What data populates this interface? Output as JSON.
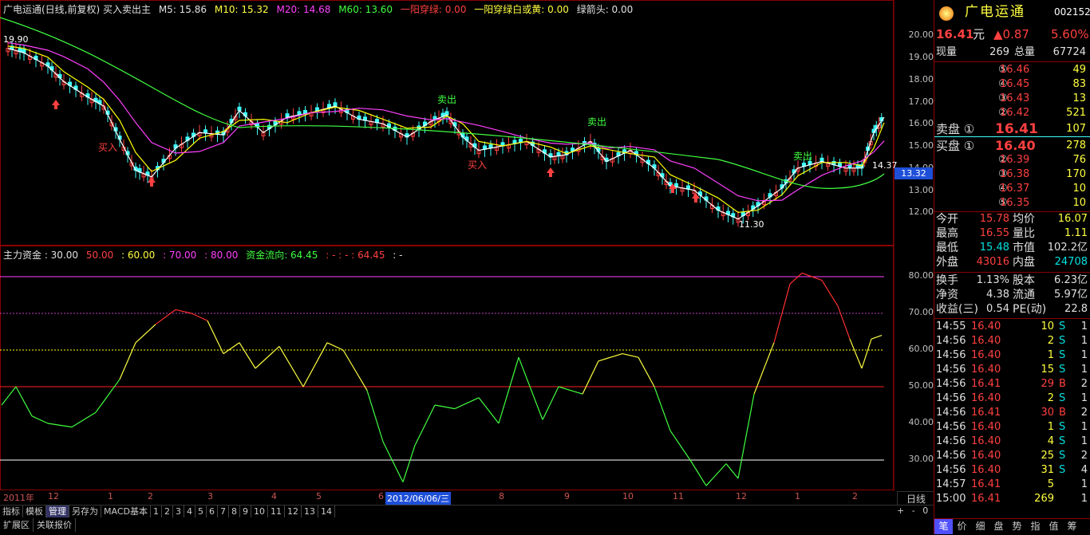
{
  "header": {
    "title": "广电运通(日线,前复权) 买入卖出主",
    "m5": "M5: 15.86",
    "m10": "M10: 15.32",
    "m20": "M20: 14.68",
    "m60": "M60: 13.60",
    "sig1": "一阳穿绿: 0.00",
    "sig2": "一阳穿绿白或黄: 0.00",
    "sig3": "绿箭头: 0.00"
  },
  "indicator_header": {
    "name": "主力资金 : 30.00",
    "v50": "50.00",
    "v60": ": 60.00",
    "v70": ": 70.00",
    "v80": ": 80.00",
    "flow": "资金流向: 64.45",
    "flow2": ": - : - : 64.45",
    "tail": ": -"
  },
  "price_axis": [
    "20.00",
    "19.00",
    "18.00",
    "17.00",
    "16.00",
    "15.00",
    "14.00",
    "13.00",
    "12.00"
  ],
  "cursor_price": "13.32",
  "ind_axis": [
    "80.00",
    "70.00",
    "60.00",
    "50.00",
    "40.00",
    "30.00"
  ],
  "chart_labels": {
    "high": "19.90",
    "low": "11.30",
    "right": "14.37",
    "buy": "买入",
    "sell": "卖出"
  },
  "x_labels": [
    "2011年",
    "12",
    "1",
    "2",
    "3",
    "4",
    "5",
    "6",
    "8",
    "9",
    "10",
    "11",
    "12",
    "1",
    "2"
  ],
  "date_cursor": "2012/06/06/三",
  "period": "日线",
  "bottom_tabs": [
    "指标",
    "模板",
    "管理",
    "另存为",
    "MACD基本",
    "1",
    "2",
    "3",
    "4",
    "5",
    "6",
    "7",
    "8",
    "9",
    "10",
    "11",
    "12",
    "13",
    "14"
  ],
  "bottom_tabs2": [
    "扩展区",
    "关联报价"
  ],
  "nav_buttons": [
    "+",
    "-",
    "0"
  ],
  "quote": {
    "name": "广电运通",
    "code": "002152",
    "price": "16.41",
    "unit": "元",
    "change": "▲0.87",
    "pct": "5.60%",
    "cur_vol_label": "现量",
    "cur_vol": "269",
    "total_vol_label": "总量",
    "total_vol": "67724",
    "asks": [
      {
        "lvl": "⑤",
        "p": "16.46",
        "v": "49"
      },
      {
        "lvl": "④",
        "p": "16.45",
        "v": "83"
      },
      {
        "lvl": "③",
        "p": "16.43",
        "v": "13"
      },
      {
        "lvl": "②",
        "p": "16.42",
        "v": "521"
      },
      {
        "lvl": "卖盘 ①",
        "p": "16.41",
        "v": "107"
      }
    ],
    "bids": [
      {
        "lvl": "买盘 ①",
        "p": "16.40",
        "v": "278"
      },
      {
        "lvl": "②",
        "p": "16.39",
        "v": "76"
      },
      {
        "lvl": "③",
        "p": "16.38",
        "v": "170"
      },
      {
        "lvl": "④",
        "p": "16.37",
        "v": "10"
      },
      {
        "lvl": "⑤",
        "p": "16.35",
        "v": "10"
      }
    ],
    "stats": [
      {
        "l1": "今开",
        "v1": "15.78",
        "l2": "均价",
        "v2": "16.07"
      },
      {
        "l1": "最高",
        "v1": "16.55",
        "l2": "量比",
        "v2": "1.11"
      },
      {
        "l1": "最低",
        "v1": "15.48",
        "l2": "市值",
        "v2": "102.2亿"
      },
      {
        "l1": "外盘",
        "v1": "43016",
        "l2": "内盘",
        "v2": "24708"
      }
    ],
    "stats2": [
      {
        "l1": "换手",
        "v1": "1.13%",
        "l2": "股本",
        "v2": "6.23亿"
      },
      {
        "l1": "净资",
        "v1": "4.38",
        "l2": "流通",
        "v2": "5.97亿"
      },
      {
        "l1": "收益(三)",
        "v1": "0.54",
        "l2": "PE(动)",
        "v2": "22.8"
      }
    ],
    "ticks": [
      {
        "t": "14:55",
        "p": "16.40",
        "v": "10",
        "s": "S",
        "n": "1"
      },
      {
        "t": "14:56",
        "p": "16.40",
        "v": "2",
        "s": "S",
        "n": "1"
      },
      {
        "t": "14:56",
        "p": "16.40",
        "v": "1",
        "s": "S",
        "n": "1"
      },
      {
        "t": "14:56",
        "p": "16.40",
        "v": "15",
        "s": "S",
        "n": "1"
      },
      {
        "t": "14:56",
        "p": "16.41",
        "v": "29",
        "s": "B",
        "n": "2"
      },
      {
        "t": "14:56",
        "p": "16.40",
        "v": "2",
        "s": "S",
        "n": "1"
      },
      {
        "t": "14:56",
        "p": "16.41",
        "v": "30",
        "s": "B",
        "n": "2"
      },
      {
        "t": "14:56",
        "p": "16.40",
        "v": "1",
        "s": "S",
        "n": "1"
      },
      {
        "t": "14:56",
        "p": "16.40",
        "v": "4",
        "s": "S",
        "n": "1"
      },
      {
        "t": "14:56",
        "p": "16.40",
        "v": "25",
        "s": "S",
        "n": "2"
      },
      {
        "t": "14:56",
        "p": "16.40",
        "v": "31",
        "s": "S",
        "n": "4"
      },
      {
        "t": "14:57",
        "p": "16.41",
        "v": "5",
        "s": "",
        "n": "1"
      },
      {
        "t": "15:00",
        "p": "16.41",
        "v": "269",
        "s": "",
        "n": "1"
      }
    ],
    "tabs": [
      "笔",
      "价",
      "细",
      "盘",
      "势",
      "指",
      "值",
      "筹"
    ]
  },
  "colors": {
    "up": "#ff4040",
    "down": "#40ffff",
    "m5": "#ffffff",
    "m10": "#ffff00",
    "m20": "#ff40ff",
    "m60": "#40ff40"
  }
}
